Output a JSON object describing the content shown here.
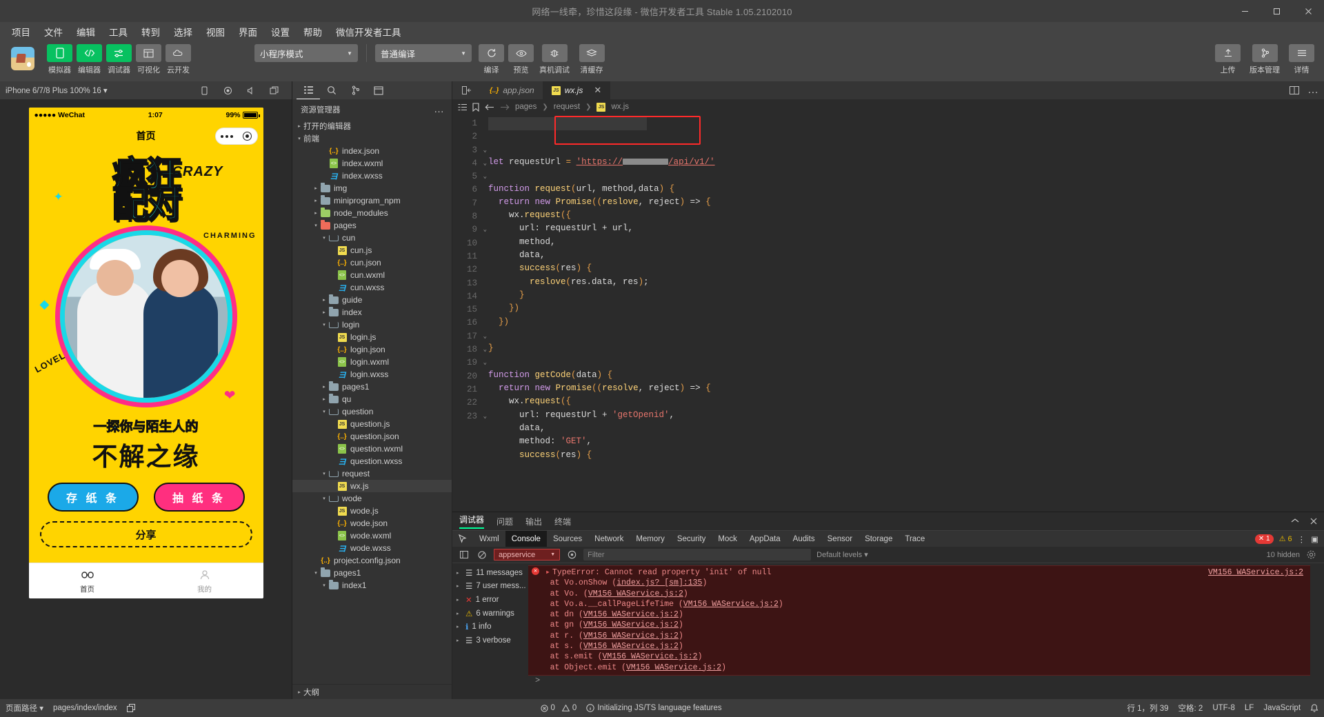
{
  "window": {
    "title": "网络一线牵，珍惜这段缘 - 微信开发者工具 Stable 1.05.2102010",
    "minimize": "—",
    "maximize": "▢",
    "close": "✕"
  },
  "menubar": [
    "项目",
    "文件",
    "编辑",
    "工具",
    "转到",
    "选择",
    "视图",
    "界面",
    "设置",
    "帮助",
    "微信开发者工具"
  ],
  "toolbar": {
    "buttons": [
      {
        "label": "模拟器",
        "icon": "phone-icon",
        "style": "green"
      },
      {
        "label": "编辑器",
        "icon": "code-icon",
        "style": "green"
      },
      {
        "label": "调试器",
        "icon": "sliders-icon",
        "style": "green"
      },
      {
        "label": "可视化",
        "icon": "layout-icon",
        "style": "gray"
      },
      {
        "label": "云开发",
        "icon": "cloud-icon",
        "style": "gray"
      }
    ],
    "mode_select": "小程序模式",
    "compile_select": "普通编译",
    "actions": [
      {
        "label": "编译",
        "icon": "refresh-icon"
      },
      {
        "label": "预览",
        "icon": "eye-icon"
      },
      {
        "label": "真机调试",
        "icon": "bug-icon"
      },
      {
        "label": "清缓存",
        "icon": "stack-icon"
      }
    ],
    "right_actions": [
      {
        "label": "上传",
        "icon": "upload-icon"
      },
      {
        "label": "版本管理",
        "icon": "branch-icon"
      },
      {
        "label": "详情",
        "icon": "menu-icon"
      }
    ]
  },
  "simulator": {
    "device": "iPhone 6/7/8 Plus 100% 16 ▾",
    "icons": [
      "rotate-icon",
      "record-icon",
      "mute-icon",
      "window-icon"
    ],
    "phone": {
      "carrier": "●●●●● WeChat",
      "time": "1:07",
      "battery": "99%",
      "nav_title": "首页",
      "hero_main": "疯狂",
      "hero_sub": "配对",
      "hero_en": "CRAZY",
      "charming": "CHARMING",
      "lovely": "LOVELY",
      "subtitle1": "一探你与陌生人的",
      "subtitle2": "不解之缘",
      "btn_left": "存 纸 条",
      "btn_right": "抽 纸 条",
      "share": "分享",
      "tabs": [
        {
          "label": "首页",
          "icon": "link-icon",
          "active": true
        },
        {
          "label": "我的",
          "icon": "user-icon",
          "active": false
        }
      ]
    }
  },
  "explorer": {
    "icons": [
      "files-icon",
      "search-icon",
      "source-control-icon",
      "debug-icon"
    ],
    "title": "资源管理器",
    "more": "…",
    "sections": [
      "打开的编辑器",
      "前端"
    ],
    "outline": "大纲",
    "tree": [
      {
        "indent": 0,
        "label": "打开的编辑器",
        "type": "section",
        "arrow": "▸"
      },
      {
        "indent": 0,
        "label": "前端",
        "type": "section",
        "arrow": "▾"
      },
      {
        "indent": 3,
        "label": "index.json",
        "type": "json",
        "arrow": ""
      },
      {
        "indent": 3,
        "label": "index.wxml",
        "type": "wxml",
        "arrow": ""
      },
      {
        "indent": 3,
        "label": "index.wxss",
        "type": "wxss",
        "arrow": ""
      },
      {
        "indent": 2,
        "label": "img",
        "type": "folder-teal",
        "arrow": "▸"
      },
      {
        "indent": 2,
        "label": "miniprogram_npm",
        "type": "folder-gray",
        "arrow": "▸"
      },
      {
        "indent": 2,
        "label": "node_modules",
        "type": "folder-green",
        "arrow": "▸"
      },
      {
        "indent": 2,
        "label": "pages",
        "type": "folder-red-open",
        "arrow": "▾"
      },
      {
        "indent": 3,
        "label": "cun",
        "type": "folder-open",
        "arrow": "▾"
      },
      {
        "indent": 4,
        "label": "cun.js",
        "type": "js",
        "arrow": ""
      },
      {
        "indent": 4,
        "label": "cun.json",
        "type": "json",
        "arrow": ""
      },
      {
        "indent": 4,
        "label": "cun.wxml",
        "type": "wxml",
        "arrow": ""
      },
      {
        "indent": 4,
        "label": "cun.wxss",
        "type": "wxss",
        "arrow": ""
      },
      {
        "indent": 3,
        "label": "guide",
        "type": "folder-gray",
        "arrow": "▸"
      },
      {
        "indent": 3,
        "label": "index",
        "type": "folder-gray",
        "arrow": "▸"
      },
      {
        "indent": 3,
        "label": "login",
        "type": "folder-open",
        "arrow": "▾"
      },
      {
        "indent": 4,
        "label": "login.js",
        "type": "js",
        "arrow": ""
      },
      {
        "indent": 4,
        "label": "login.json",
        "type": "json",
        "arrow": ""
      },
      {
        "indent": 4,
        "label": "login.wxml",
        "type": "wxml",
        "arrow": ""
      },
      {
        "indent": 4,
        "label": "login.wxss",
        "type": "wxss",
        "arrow": ""
      },
      {
        "indent": 3,
        "label": "pages1",
        "type": "folder-gray",
        "arrow": "▸"
      },
      {
        "indent": 3,
        "label": "qu",
        "type": "folder-gray",
        "arrow": "▸"
      },
      {
        "indent": 3,
        "label": "question",
        "type": "folder-open",
        "arrow": "▾"
      },
      {
        "indent": 4,
        "label": "question.js",
        "type": "js",
        "arrow": ""
      },
      {
        "indent": 4,
        "label": "question.json",
        "type": "json",
        "arrow": ""
      },
      {
        "indent": 4,
        "label": "question.wxml",
        "type": "wxml",
        "arrow": ""
      },
      {
        "indent": 4,
        "label": "question.wxss",
        "type": "wxss",
        "arrow": ""
      },
      {
        "indent": 3,
        "label": "request",
        "type": "folder-open",
        "arrow": "▾"
      },
      {
        "indent": 4,
        "label": "wx.js",
        "type": "js",
        "arrow": "",
        "selected": true
      },
      {
        "indent": 3,
        "label": "wode",
        "type": "folder-open",
        "arrow": "▾"
      },
      {
        "indent": 4,
        "label": "wode.js",
        "type": "js",
        "arrow": ""
      },
      {
        "indent": 4,
        "label": "wode.json",
        "type": "json",
        "arrow": ""
      },
      {
        "indent": 4,
        "label": "wode.wxml",
        "type": "wxml",
        "arrow": ""
      },
      {
        "indent": 4,
        "label": "wode.wxss",
        "type": "wxss",
        "arrow": ""
      },
      {
        "indent": 2,
        "label": "project.config.json",
        "type": "json",
        "arrow": ""
      },
      {
        "indent": 2,
        "label": "pages1",
        "type": "folder-gray",
        "arrow": "▾"
      },
      {
        "indent": 3,
        "label": "index1",
        "type": "folder-gray",
        "arrow": "▾"
      }
    ]
  },
  "editor": {
    "tabs": [
      {
        "label": "app.json",
        "type": "json",
        "active": false
      },
      {
        "label": "wx.js",
        "type": "js",
        "active": true
      }
    ],
    "close": "✕",
    "breadcrumb": [
      "pages",
      "request",
      "wx.js"
    ],
    "lines": [
      {
        "n": "1",
        "fold": "",
        "text": "let requestUrl = 'https://▒▒▒▒▒/api/v1/'"
      },
      {
        "n": "2",
        "fold": "",
        "text": ""
      },
      {
        "n": "3",
        "fold": "⌄",
        "text": "function request(url, method,data) {"
      },
      {
        "n": "4",
        "fold": "⌄",
        "text": "  return new Promise((reslove, reject) => {"
      },
      {
        "n": "5",
        "fold": "⌄",
        "text": "    wx.request({"
      },
      {
        "n": "6",
        "fold": "",
        "text": "      url: requestUrl + url,"
      },
      {
        "n": "7",
        "fold": "",
        "text": "      method,"
      },
      {
        "n": "8",
        "fold": "",
        "text": "      data,"
      },
      {
        "n": "9",
        "fold": "⌄",
        "text": "      success(res) {"
      },
      {
        "n": "10",
        "fold": "",
        "text": "        reslove(res.data, res);"
      },
      {
        "n": "11",
        "fold": "",
        "text": "      }"
      },
      {
        "n": "12",
        "fold": "",
        "text": "    })"
      },
      {
        "n": "13",
        "fold": "",
        "text": "  })"
      },
      {
        "n": "14",
        "fold": "",
        "text": ""
      },
      {
        "n": "15",
        "fold": "",
        "text": "}"
      },
      {
        "n": "16",
        "fold": "",
        "text": ""
      },
      {
        "n": "17",
        "fold": "⌄",
        "text": "function getCode(data) {"
      },
      {
        "n": "18",
        "fold": "⌄",
        "text": "  return new Promise((resolve, reject) => {"
      },
      {
        "n": "19",
        "fold": "⌄",
        "text": "    wx.request({"
      },
      {
        "n": "20",
        "fold": "",
        "text": "      url: requestUrl + 'getOpenid',"
      },
      {
        "n": "21",
        "fold": "",
        "text": "      data,"
      },
      {
        "n": "22",
        "fold": "",
        "text": "      method: 'GET',"
      },
      {
        "n": "23",
        "fold": "⌄",
        "text": "      success(res) {"
      }
    ]
  },
  "panel": {
    "tabs": [
      {
        "label": "调试器",
        "active": true
      },
      {
        "label": "问题",
        "active": false
      },
      {
        "label": "输出",
        "active": false
      },
      {
        "label": "终端",
        "active": false
      }
    ],
    "devtools_tabs": [
      "Wxml",
      "Console",
      "Sources",
      "Network",
      "Memory",
      "Security",
      "Mock",
      "AppData",
      "Audits",
      "Sensor",
      "Storage",
      "Trace"
    ],
    "active_devtool": "Console",
    "error_count": "1",
    "warn_count": "6",
    "context": "appservice",
    "filter_placeholder": "Filter",
    "levels": "Default levels ▾",
    "hidden": "10 hidden",
    "counts": [
      {
        "label": "11 messages",
        "icon": "list-icon"
      },
      {
        "label": "7 user mess...",
        "icon": "user-icon"
      },
      {
        "label": "1 error",
        "icon": "error-icon"
      },
      {
        "label": "6 warnings",
        "icon": "warn-icon"
      },
      {
        "label": "1 info",
        "icon": "info-icon"
      },
      {
        "label": "3 verbose",
        "icon": "verbose-icon"
      }
    ],
    "error_source": "VM156 WAService.js:2",
    "error_lines": [
      {
        "text": "TypeError: Cannot read property 'init' of null",
        "head": true
      },
      {
        "text": "    at Vo.onShow (",
        "link": "index.js? [sm]:135",
        "tail": ")"
      },
      {
        "text": "    at Vo.<anonymous> (",
        "link": "VM156 WAService.js:2",
        "tail": ")"
      },
      {
        "text": "    at Vo.a.__callPageLifeTime (",
        "link": "VM156 WAService.js:2",
        "tail": ")"
      },
      {
        "text": "    at dn (",
        "link": "VM156 WAService.js:2",
        "tail": ")"
      },
      {
        "text": "    at gn (",
        "link": "VM156 WAService.js:2",
        "tail": ")"
      },
      {
        "text": "    at r.<anonymous> (",
        "link": "VM156 WAService.js:2",
        "tail": ")"
      },
      {
        "text": "    at s.<anonymous> (",
        "link": "VM156 WAService.js:2",
        "tail": ")"
      },
      {
        "text": "    at s.emit (",
        "link": "VM156 WAService.js:2",
        "tail": ")"
      },
      {
        "text": "    at Object.emit (",
        "link": "VM156 WAService.js:2",
        "tail": ")"
      }
    ],
    "prompt": ">"
  },
  "status": {
    "left_label": "页面路径 ▾",
    "path": "pages/index/index",
    "copy_icon": "copy-icon",
    "eye_icon": "eye-icon",
    "more_icon": "more-icon",
    "errors": "0",
    "warnings": "0",
    "message": "Initializing JS/TS language features",
    "position": "行 1，列 39",
    "spaces": "空格: 2",
    "encoding": "UTF-8",
    "eol": "LF",
    "language": "JavaScript",
    "bell_icon": "bell-icon"
  }
}
